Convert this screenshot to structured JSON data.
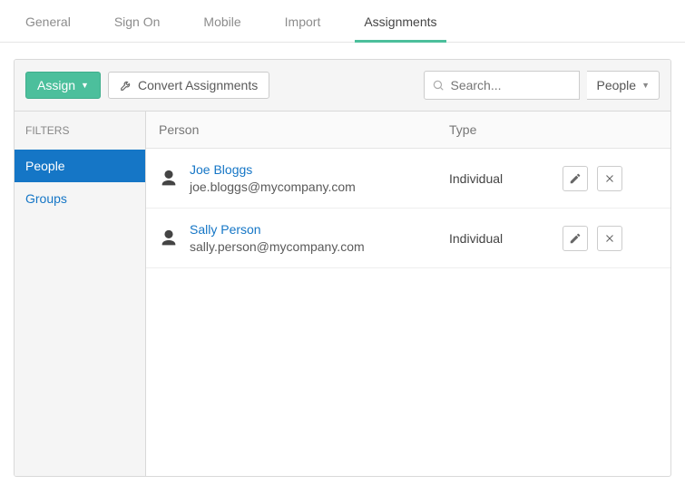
{
  "tabs": [
    {
      "label": "General",
      "active": false
    },
    {
      "label": "Sign On",
      "active": false
    },
    {
      "label": "Mobile",
      "active": false
    },
    {
      "label": "Import",
      "active": false
    },
    {
      "label": "Assignments",
      "active": true
    }
  ],
  "toolbar": {
    "assign_label": "Assign",
    "convert_label": "Convert Assignments",
    "search_placeholder": "Search...",
    "search_filter_label": "People"
  },
  "sidebar": {
    "header": "Filters",
    "items": [
      {
        "label": "People",
        "active": true
      },
      {
        "label": "Groups",
        "active": false
      }
    ]
  },
  "table": {
    "columns": {
      "person": "Person",
      "type": "Type"
    },
    "rows": [
      {
        "name": "Joe Bloggs",
        "email": "joe.bloggs@mycompany.com",
        "type": "Individual"
      },
      {
        "name": "Sally Person",
        "email": "sally.person@mycompany.com",
        "type": "Individual"
      }
    ]
  }
}
